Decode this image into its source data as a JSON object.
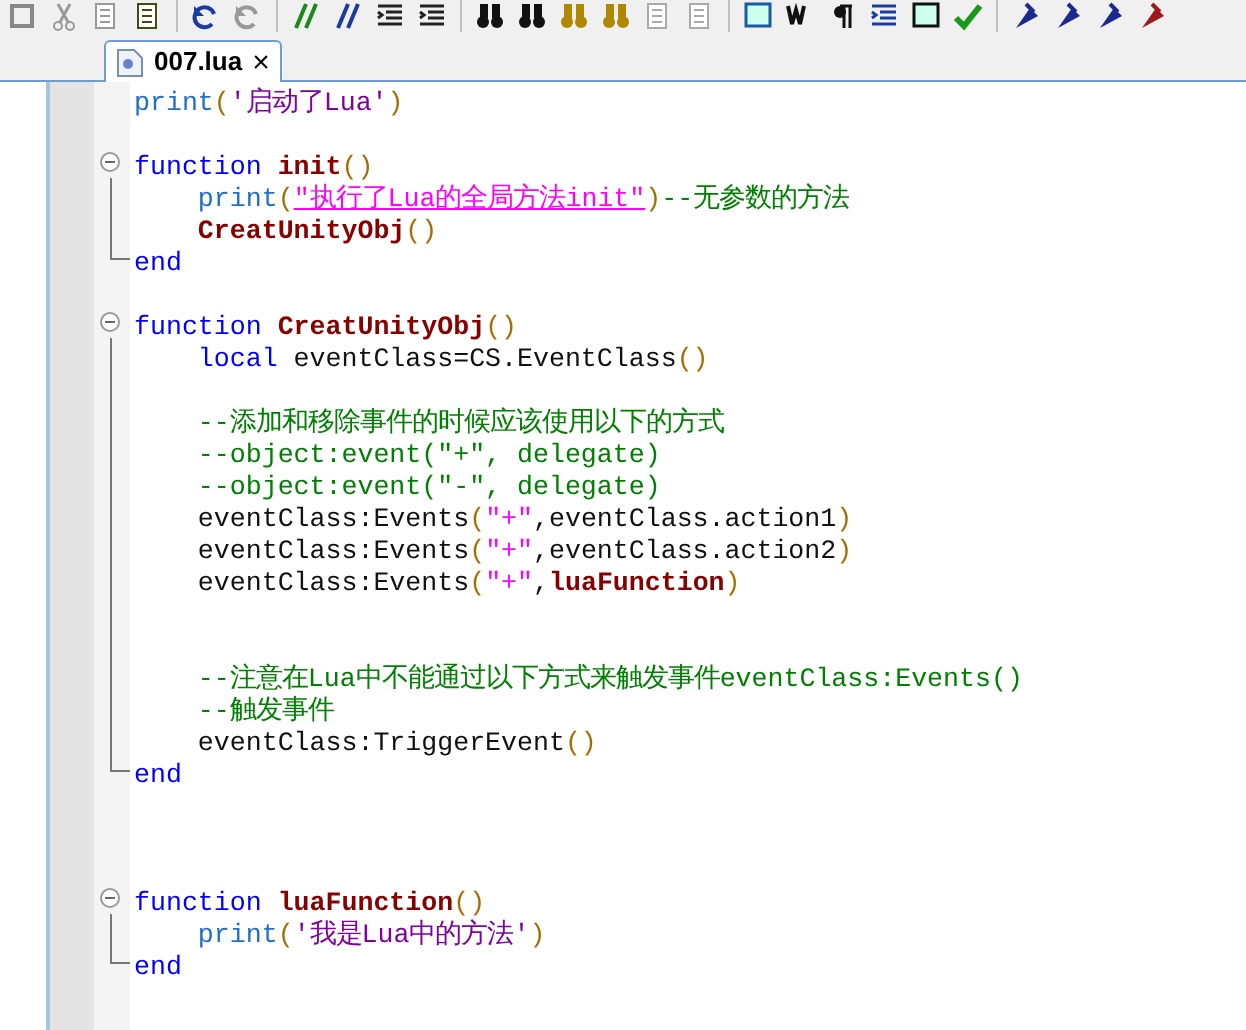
{
  "tabs": [
    {
      "label": "007.lua",
      "selected": true,
      "close": "×"
    }
  ],
  "lines": [
    {
      "kind": "plain",
      "tokens": [
        {
          "kind": "builtin",
          "t": "print"
        },
        {
          "kind": "paren",
          "t": "("
        },
        {
          "kind": "string",
          "t": "'启动了Lua'"
        },
        {
          "kind": "paren",
          "t": ")"
        }
      ]
    },
    {
      "kind": "blank"
    },
    {
      "kind": "start",
      "tokens": [
        {
          "kind": "keyword",
          "t": "function "
        },
        {
          "kind": "name",
          "t": "init"
        },
        {
          "kind": "paren",
          "t": "()"
        }
      ]
    },
    {
      "kind": "body",
      "tokens": [
        {
          "kind": "builtin",
          "t": "    print"
        },
        {
          "kind": "paren",
          "t": "("
        },
        {
          "kind": "link",
          "t": "\"执行了Lua的全局方法init\""
        },
        {
          "kind": "paren",
          "t": ")"
        },
        {
          "kind": "comment",
          "t": "--无参数的方法"
        }
      ]
    },
    {
      "kind": "body",
      "tokens": [
        {
          "kind": "name",
          "t": "    CreatUnityObj"
        },
        {
          "kind": "paren",
          "t": "()"
        }
      ]
    },
    {
      "kind": "end",
      "tokens": [
        {
          "kind": "keyword",
          "t": "end"
        }
      ]
    },
    {
      "kind": "blank"
    },
    {
      "kind": "start",
      "tokens": [
        {
          "kind": "keyword",
          "t": "function "
        },
        {
          "kind": "name",
          "t": "CreatUnityObj"
        },
        {
          "kind": "paren",
          "t": "()"
        }
      ]
    },
    {
      "kind": "body",
      "tokens": [
        {
          "kind": "keyword",
          "t": "    local"
        },
        {
          "kind": "plain",
          "t": " eventClass=CS.EventClass"
        },
        {
          "kind": "paren",
          "t": "()"
        }
      ]
    },
    {
      "kind": "body"
    },
    {
      "kind": "body",
      "tokens": [
        {
          "kind": "comment",
          "t": "    --添加和移除事件的时候应该使用以下的方式"
        }
      ]
    },
    {
      "kind": "body",
      "tokens": [
        {
          "kind": "comment",
          "t": "    --object:event(\"+\", delegate)"
        }
      ]
    },
    {
      "kind": "body",
      "tokens": [
        {
          "kind": "comment",
          "t": "    --object:event(\"-\", delegate)"
        }
      ]
    },
    {
      "kind": "body",
      "tokens": [
        {
          "kind": "plain",
          "t": "    eventClass:Events"
        },
        {
          "kind": "paren",
          "t": "("
        },
        {
          "kind": "op",
          "t": "\"+\""
        },
        {
          "kind": "plain",
          "t": ",eventClass.action1"
        },
        {
          "kind": "paren",
          "t": ")"
        }
      ]
    },
    {
      "kind": "body",
      "tokens": [
        {
          "kind": "plain",
          "t": "    eventClass:Events"
        },
        {
          "kind": "paren",
          "t": "("
        },
        {
          "kind": "op",
          "t": "\"+\""
        },
        {
          "kind": "plain",
          "t": ",eventClass.action2"
        },
        {
          "kind": "paren",
          "t": ")"
        }
      ]
    },
    {
      "kind": "body",
      "tokens": [
        {
          "kind": "plain",
          "t": "    eventClass:Events"
        },
        {
          "kind": "paren",
          "t": "("
        },
        {
          "kind": "op",
          "t": "\"+\""
        },
        {
          "kind": "plain",
          "t": ","
        },
        {
          "kind": "name",
          "t": "luaFunction"
        },
        {
          "kind": "paren",
          "t": ")"
        }
      ]
    },
    {
      "kind": "body"
    },
    {
      "kind": "body"
    },
    {
      "kind": "body",
      "tokens": [
        {
          "kind": "comment",
          "t": "    --注意在Lua中不能通过以下方式来触发事件eventClass:Events()"
        }
      ]
    },
    {
      "kind": "body",
      "tokens": [
        {
          "kind": "comment",
          "t": "    --触发事件"
        }
      ]
    },
    {
      "kind": "body",
      "tokens": [
        {
          "kind": "plain",
          "t": "    eventClass:TriggerEvent"
        },
        {
          "kind": "paren",
          "t": "()"
        }
      ]
    },
    {
      "kind": "end",
      "tokens": [
        {
          "kind": "keyword",
          "t": "end"
        }
      ]
    },
    {
      "kind": "blank"
    },
    {
      "kind": "blank"
    },
    {
      "kind": "blank"
    },
    {
      "kind": "start",
      "tokens": [
        {
          "kind": "keyword",
          "t": "function "
        },
        {
          "kind": "name",
          "t": "luaFunction"
        },
        {
          "kind": "paren",
          "t": "()"
        }
      ]
    },
    {
      "kind": "body",
      "tokens": [
        {
          "kind": "builtin",
          "t": "    print"
        },
        {
          "kind": "paren",
          "t": "("
        },
        {
          "kind": "string",
          "t": "'我是Lua中的方法'"
        },
        {
          "kind": "paren",
          "t": ")"
        }
      ]
    },
    {
      "kind": "end",
      "tokens": [
        {
          "kind": "keyword",
          "t": "end"
        }
      ]
    }
  ]
}
